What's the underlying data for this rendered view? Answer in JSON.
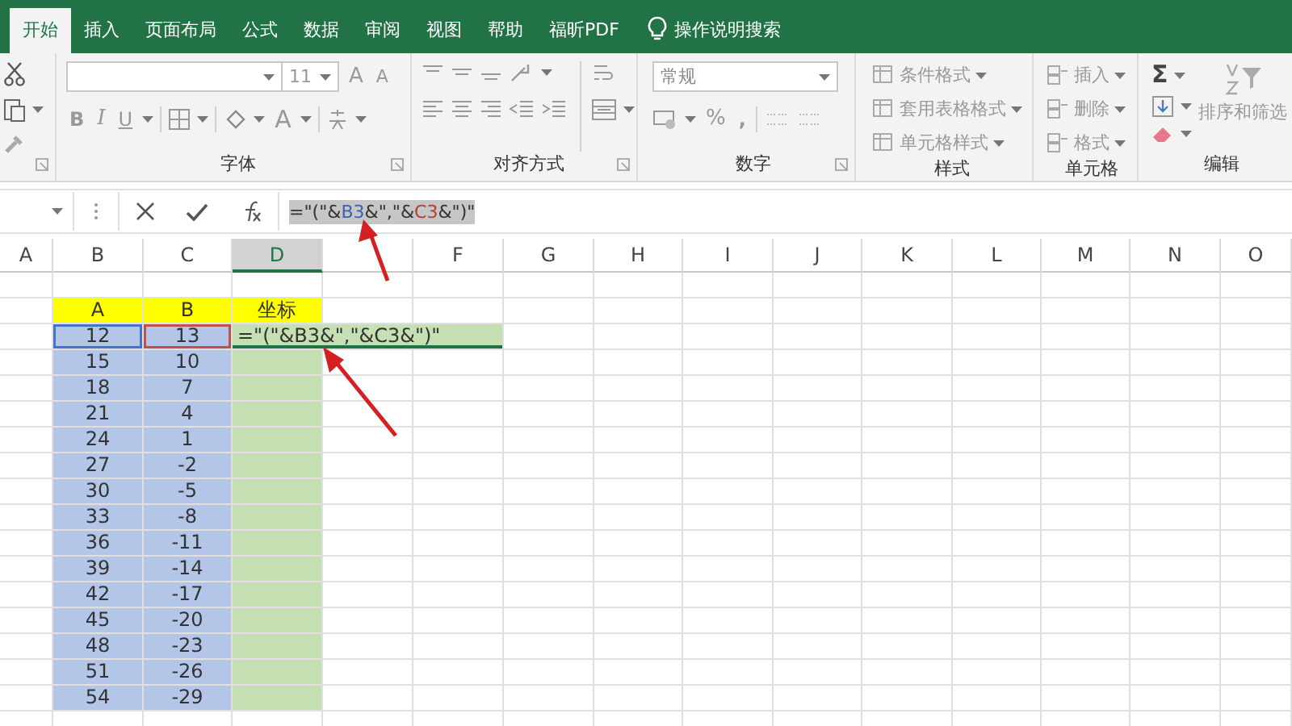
{
  "tabs": [
    {
      "label": "开始",
      "selected": true
    },
    {
      "label": "插入",
      "selected": false
    },
    {
      "label": "页面布局",
      "selected": false
    },
    {
      "label": "公式",
      "selected": false
    },
    {
      "label": "数据",
      "selected": false
    },
    {
      "label": "审阅",
      "selected": false
    },
    {
      "label": "视图",
      "selected": false
    },
    {
      "label": "帮助",
      "selected": false
    },
    {
      "label": "福昕PDF",
      "selected": false
    }
  ],
  "tell_me": {
    "label": "操作说明搜索"
  },
  "ribbon": {
    "font": {
      "size": "11",
      "grow": "A",
      "shrink": "A",
      "bold": "B",
      "italic": "I",
      "underline": "U",
      "font_color": "A",
      "label": "字体"
    },
    "alignment": {
      "label": "对齐方式"
    },
    "number": {
      "format": "常规",
      "percent": "%",
      "comma": ",",
      "label": "数字"
    },
    "styles": {
      "buttons": [
        {
          "label": "条件格式",
          "disabled": true
        },
        {
          "label": "套用表格格式",
          "disabled": true
        },
        {
          "label": "单元格样式",
          "disabled": true
        }
      ],
      "label": "样式"
    },
    "cells": {
      "buttons": [
        {
          "label": "插入",
          "disabled": true
        },
        {
          "label": "删除",
          "disabled": true
        },
        {
          "label": "格式",
          "disabled": true
        }
      ],
      "label": "单元格"
    },
    "editing": {
      "sum": "Σ",
      "sort": {
        "label": "排序和筛选",
        "disabled": true
      },
      "label": "编辑"
    }
  },
  "formula_bar": {
    "parts": [
      {
        "text": "=\"(\"&",
        "color": "#333333"
      },
      {
        "text": "B3",
        "color": "#3a62b8"
      },
      {
        "text": "&\",\"&",
        "color": "#333333"
      },
      {
        "text": "C3",
        "color": "#b83c32"
      },
      {
        "text": "&\")\"",
        "color": "#333333"
      }
    ]
  },
  "columns": [
    {
      "label": "A",
      "selected": false
    },
    {
      "label": "B",
      "selected": false
    },
    {
      "label": "C",
      "selected": false
    },
    {
      "label": "D",
      "selected": true
    },
    {
      "selected": false
    },
    {
      "label": "F",
      "selected": false
    },
    {
      "label": "G",
      "selected": false
    },
    {
      "label": "H",
      "selected": false
    },
    {
      "label": "I",
      "selected": false
    },
    {
      "label": "J",
      "selected": false
    },
    {
      "label": "K",
      "selected": false
    },
    {
      "label": "L",
      "selected": false
    },
    {
      "label": "M",
      "selected": false
    },
    {
      "label": "N",
      "selected": false
    },
    {
      "label": "O",
      "selected": false
    }
  ],
  "rows": [
    {
      "kind": "empty"
    },
    {
      "kind": "header",
      "cells": [
        "A",
        "B",
        "坐标"
      ]
    },
    {
      "kind": "editing",
      "cells": [
        "12",
        "13",
        "=\"(\"&B3&\",\"&C3&\")\""
      ]
    },
    {
      "kind": "data",
      "cells": [
        "15",
        "10"
      ]
    },
    {
      "kind": "data",
      "cells": [
        "18",
        "7"
      ]
    },
    {
      "kind": "data",
      "cells": [
        "21",
        "4"
      ]
    },
    {
      "kind": "data",
      "cells": [
        "24",
        "1"
      ]
    },
    {
      "kind": "data",
      "cells": [
        "27",
        "-2"
      ]
    },
    {
      "kind": "data",
      "cells": [
        "30",
        "-5"
      ]
    },
    {
      "kind": "data",
      "cells": [
        "33",
        "-8"
      ]
    },
    {
      "kind": "data",
      "cells": [
        "36",
        "-11"
      ]
    },
    {
      "kind": "data",
      "cells": [
        "39",
        "-14"
      ]
    },
    {
      "kind": "data",
      "cells": [
        "42",
        "-17"
      ]
    },
    {
      "kind": "data",
      "cells": [
        "45",
        "-20"
      ]
    },
    {
      "kind": "data",
      "cells": [
        "48",
        "-23"
      ]
    },
    {
      "kind": "data",
      "cells": [
        "51",
        "-26"
      ]
    },
    {
      "kind": "data",
      "cells": [
        "54",
        "-29"
      ]
    },
    {
      "kind": "empty"
    }
  ]
}
